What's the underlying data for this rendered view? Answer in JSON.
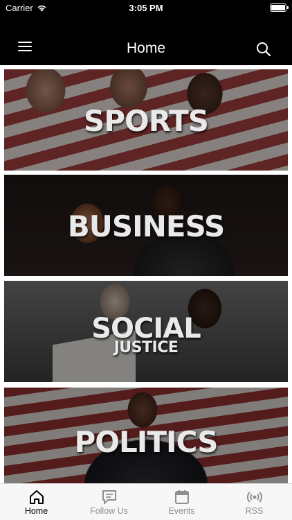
{
  "status_bar": {
    "carrier": "Carrier",
    "time": "3:05 PM",
    "battery_level": 1.0
  },
  "header": {
    "title": "Home",
    "menu_icon": "hamburger-menu-icon",
    "search_icon": "search-icon"
  },
  "categories": [
    {
      "title": "SPORTS",
      "subtitle": ""
    },
    {
      "title": "BUSINESS",
      "subtitle": ""
    },
    {
      "title": "SOCIAL",
      "subtitle": "JUSTICE"
    },
    {
      "title": "POLITICS",
      "subtitle": ""
    }
  ],
  "tabs": [
    {
      "label": "Home",
      "icon": "home-icon",
      "active": true
    },
    {
      "label": "Follow Us",
      "icon": "chat-bubble-icon",
      "active": false
    },
    {
      "label": "Events",
      "icon": "calendar-icon",
      "active": false
    },
    {
      "label": "RSS",
      "icon": "broadcast-icon",
      "active": false
    }
  ],
  "colors": {
    "bar_background": "#000000",
    "tab_active": "#000000",
    "tab_inactive": "#8e8e93"
  }
}
